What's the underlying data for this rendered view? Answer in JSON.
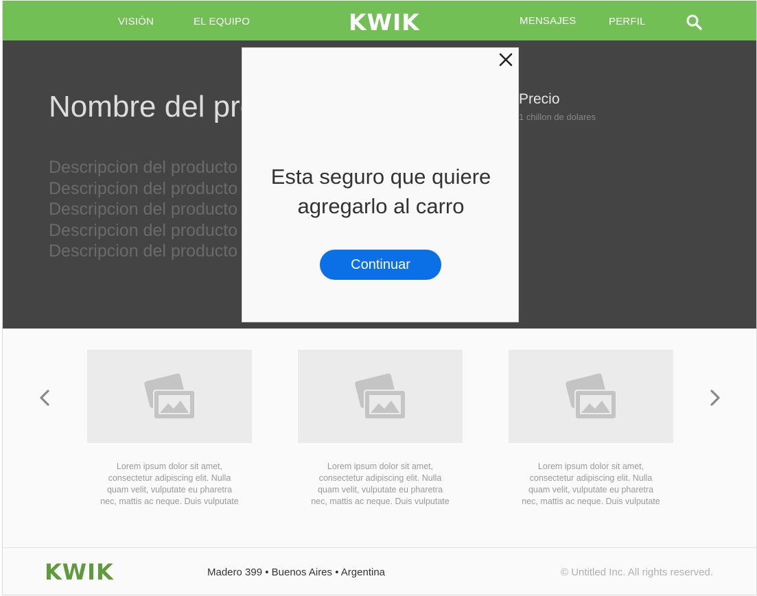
{
  "header": {
    "nav_left": [
      "VISIÓN",
      "EL EQUIPO"
    ],
    "brand": "KWIK",
    "nav_right": [
      "MENSAJES",
      "PERFIL"
    ],
    "search_icon": "search-icon",
    "background_color": "#72bf56"
  },
  "hero": {
    "product_name": "Nombre del producto",
    "description_lines": [
      "Descripcion del producto",
      "Descripcion del producto",
      "Descripcion del producto",
      "Descripcion del producto",
      "Descripcion del producto"
    ],
    "price_label": "Precio",
    "price_value": "1 chillon de dolares",
    "background_color": "#444444"
  },
  "carousel": {
    "prev_icon": "chevron-left-icon",
    "next_icon": "chevron-right-icon",
    "cards": [
      {
        "image_icon": "image-placeholder-icon",
        "text": "Lorem ipsum dolor sit amet, consectetur adipiscing elit. Nulla quam velit, vulputate eu pharetra nec, mattis ac neque. Duis vulputate"
      },
      {
        "image_icon": "image-placeholder-icon",
        "text": "Lorem ipsum dolor sit amet, consectetur adipiscing elit. Nulla quam velit, vulputate eu pharetra nec, mattis ac neque. Duis vulputate"
      },
      {
        "image_icon": "image-placeholder-icon",
        "text": "Lorem ipsum dolor sit amet, consectetur adipiscing elit. Nulla quam velit, vulputate eu pharetra nec, mattis ac neque. Duis vulputate"
      }
    ]
  },
  "footer": {
    "brand": "KWIK",
    "address": "Madero 399 • Buenos Aires • Argentina",
    "copyright": "© Untitled Inc. All rights reserved."
  },
  "modal": {
    "message": "Esta seguro que quiere agregarlo al carro",
    "button_label": "Continuar",
    "close_icon": "close-icon",
    "button_color": "#0b6fe5"
  }
}
